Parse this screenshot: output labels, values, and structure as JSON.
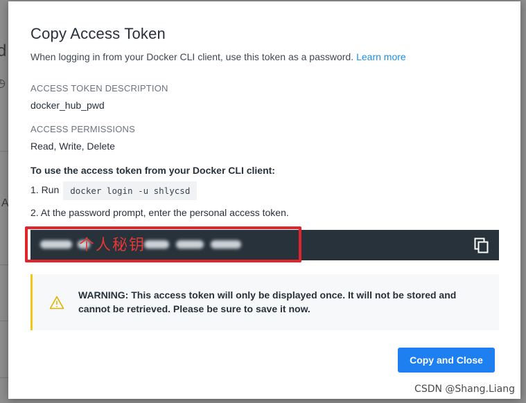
{
  "modal": {
    "title": "Copy Access Token",
    "subtitle": "When logging in from your Docker CLI client, use this token as a password.",
    "learn_more": "Learn more",
    "description_label": "ACCESS TOKEN DESCRIPTION",
    "description_value": "docker_hub_pwd",
    "permissions_label": "ACCESS PERMISSIONS",
    "permissions_value": "Read, Write, Delete",
    "instructions_heading": "To use the access token from your Docker CLI client:",
    "step1_prefix": "1. Run",
    "step1_command": "docker login -u shlycsd",
    "step2": "2. At the password prompt, enter the personal access token.",
    "token_annotation": "个人秘钥",
    "warning": "WARNING: This access token will only be displayed once. It will not be stored and cannot be retrieved. Please be sure to save it now.",
    "button_label": "Copy and Close"
  },
  "background": {
    "fragment_1": "d",
    "fragment_2": "A"
  },
  "watermark": "CSDN @Shang.Liang",
  "colors": {
    "accent": "#1d7ff0",
    "token_bg": "#27323b",
    "annotation": "#e0242c",
    "warning_bar": "#f2c615"
  }
}
